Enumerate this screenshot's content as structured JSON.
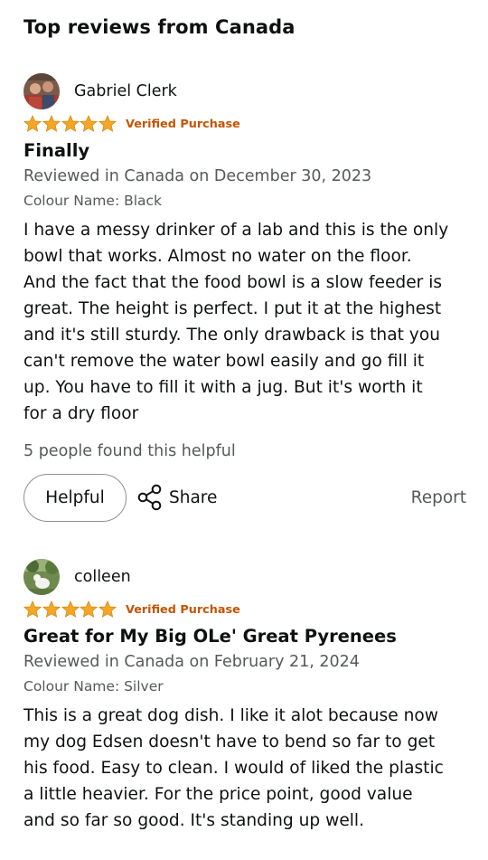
{
  "section_title": "Top reviews from Canada",
  "colors": {
    "star": "#f5a623",
    "verified": "#c45500",
    "secondary_text": "#565959",
    "primary_text": "#0f1111"
  },
  "reviews": [
    {
      "reviewer": "Gabriel Clerk",
      "avatar_icon": "avatar-icon",
      "rating": 5,
      "max_rating": 5,
      "verified": "Verified Purchase",
      "title": "Finally",
      "reviewed_in": "Reviewed in Canada on December 30, 2023",
      "variant": "Colour Name: Black",
      "body": "I have a messy drinker of a lab and this is the only\nbowl that works. Almost no water on the floor.\nAnd the fact that the food bowl is a slow feeder is\ngreat. The height is perfect. I put it at the highest\nand it's still sturdy. The only drawback is that you\ncan't remove the water bowl easily and go fill it\nup. You have to fill it with a jug. But it's worth it\nfor a dry floor",
      "helpful_count": "5 people found this helpful",
      "helpful_label": "Helpful",
      "share_label": "Share",
      "report_label": "Report"
    },
    {
      "reviewer": "colleen",
      "avatar_icon": "avatar-icon",
      "rating": 5,
      "max_rating": 5,
      "verified": "Verified Purchase",
      "title": "Great for My Big OLe' Great Pyrenees",
      "reviewed_in": "Reviewed in Canada on February 21, 2024",
      "variant": "Colour Name: Silver",
      "body": "This is a great dog dish. I like it alot because now\nmy dog Edsen doesn't have to bend so far to get\nhis food. Easy to clean. I would of liked the plastic\na little heavier. For the price point, good value\nand so far so good. It's standing up well."
    }
  ]
}
